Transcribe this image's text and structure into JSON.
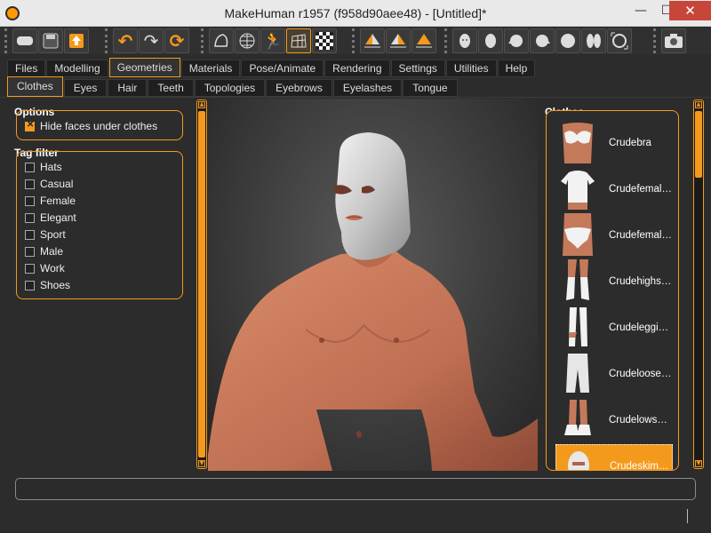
{
  "window": {
    "title": "MakeHuman r1957 (f958d90aee48) - [Untitled]*",
    "min_symbol": "—",
    "max_symbol": "☐",
    "close_symbol": "✕"
  },
  "toolbar": {
    "groups": [
      [
        "wireframe-toggle-icon",
        "save-icon",
        "export-icon"
      ],
      [
        "undo-icon",
        "redo-icon",
        "reset-icon"
      ],
      [
        "smooth-icon",
        "wireframe-icon",
        "pose-icon",
        "grid-icon",
        "checker-icon"
      ],
      [
        "front-view-icon",
        "back-view-icon",
        "left-view-icon"
      ],
      [
        "face-front-icon",
        "face-back-icon",
        "face-left-icon",
        "face-right-icon",
        "face-top-icon",
        "face-bottom-icon",
        "reset-camera-icon"
      ],
      [
        "screenshot-icon"
      ]
    ]
  },
  "tabs": {
    "main": [
      "Files",
      "Modelling",
      "Geometries",
      "Materials",
      "Pose/Animate",
      "Rendering",
      "Settings",
      "Utilities",
      "Help"
    ],
    "main_selected": "Geometries",
    "sub": [
      "Clothes",
      "Eyes",
      "Hair",
      "Teeth",
      "Topologies",
      "Eyebrows",
      "Eyelashes",
      "Tongue"
    ],
    "sub_selected": "Clothes"
  },
  "left": {
    "options_title": "Options",
    "hide_faces": {
      "label": "Hide faces under clothes",
      "checked": true
    },
    "tag_filter_title": "Tag filter",
    "tags": [
      "Hats",
      "Casual",
      "Female",
      "Elegant",
      "Sport",
      "Male",
      "Work",
      "Shoes"
    ]
  },
  "right": {
    "title": "Clothes",
    "items": [
      "Crudebra",
      "Crudefemaletshirt",
      "Crudefemalepanties",
      "Crudehighsocks",
      "Crudeleggings",
      "Crudeloosepants",
      "Crudelowshoes",
      "Crudeskimask"
    ],
    "selected": "Crudeskimask"
  },
  "colors": {
    "accent": "#f39a1d",
    "background": "#2c2c2c",
    "skin": "#c8765a",
    "mask": "#d8d8d8"
  }
}
